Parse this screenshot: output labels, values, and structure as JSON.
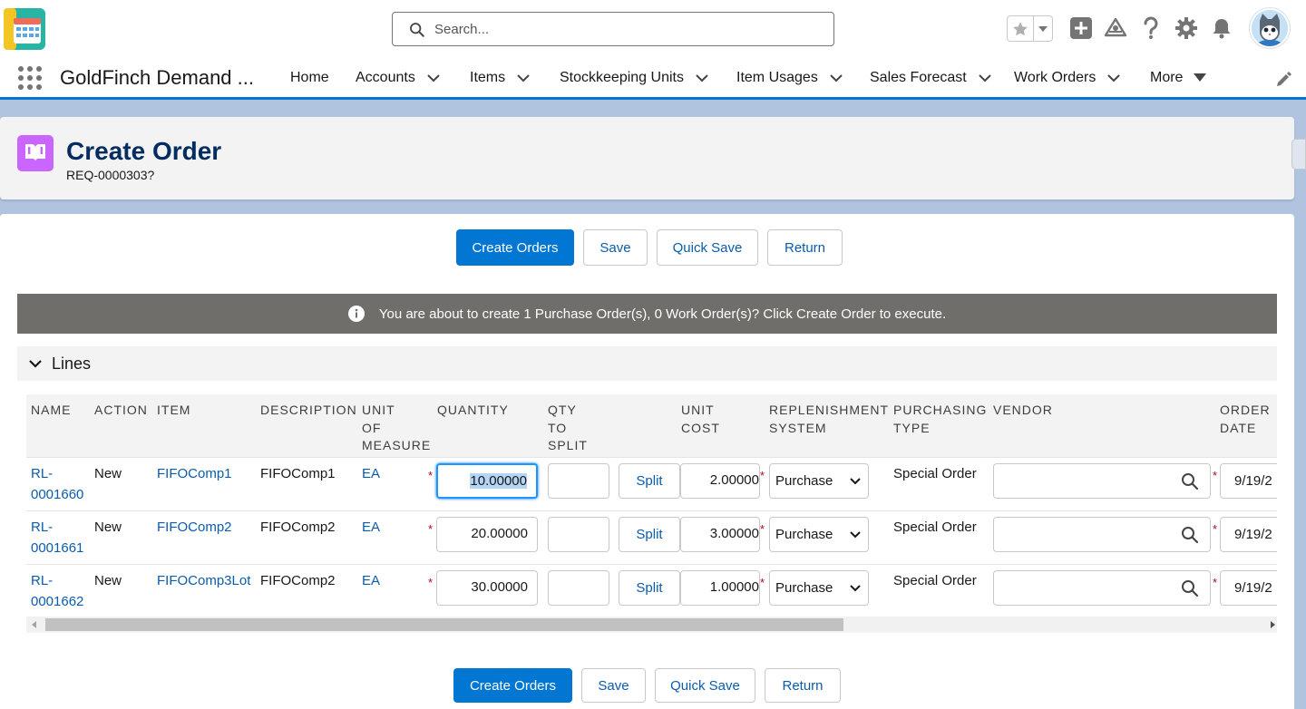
{
  "header": {
    "search_placeholder": "Search..."
  },
  "nav": {
    "app_name": "GoldFinch Demand ...",
    "items": [
      {
        "label": "Home"
      },
      {
        "label": "Accounts"
      },
      {
        "label": "Items"
      },
      {
        "label": "Stockkeeping Units"
      },
      {
        "label": "Item Usages"
      },
      {
        "label": "Sales Forecast"
      },
      {
        "label": "Work Orders"
      },
      {
        "label": "More"
      }
    ]
  },
  "page": {
    "title": "Create Order",
    "subtitle": "REQ-0000303?"
  },
  "actions": {
    "create_orders": "Create Orders",
    "save": "Save",
    "quick_save": "Quick Save",
    "return": "Return"
  },
  "info_message": "You are about to create 1 Purchase Order(s), 0 Work Order(s)? Click Create Order to execute.",
  "lines_section": {
    "title": "Lines",
    "columns": {
      "name": "NAME",
      "action": "ACTION",
      "item": "ITEM",
      "description": "DESCRIPTION",
      "uom_1": "UNIT",
      "uom_2": "OF",
      "uom_3": "MEASURE",
      "quantity": "QUANTITY",
      "qty_split_1": "QTY",
      "qty_split_2": "TO",
      "qty_split_3": "SPLIT",
      "unit_cost_1": "UNIT",
      "unit_cost_2": "COST",
      "repl_1": "REPLENISHMENT",
      "repl_2": "SYSTEM",
      "ptype_1": "PURCHASING",
      "ptype_2": "TYPE",
      "vendor": "VENDOR",
      "odate_1": "ORDER",
      "odate_2": "DATE"
    },
    "rows": [
      {
        "name_1": "RL-",
        "name_2": "0001660",
        "action": "New",
        "item": "FIFOComp1",
        "description": "FIFOComp1",
        "uom": "EA",
        "quantity": "10.00000",
        "qty_to_split": "",
        "split_label": "Split",
        "unit_cost": "2.00000",
        "replenishment": "Purchase",
        "purchasing_type": "Special Order",
        "vendor": "",
        "order_date": "9/19/2"
      },
      {
        "name_1": "RL-",
        "name_2": "0001661",
        "action": "New",
        "item": "FIFOComp2",
        "description": "FIFOComp2",
        "uom": "EA",
        "quantity": "20.00000",
        "qty_to_split": "",
        "split_label": "Split",
        "unit_cost": "3.00000",
        "replenishment": "Purchase",
        "purchasing_type": "Special Order",
        "vendor": "",
        "order_date": "9/19/2"
      },
      {
        "name_1": "RL-",
        "name_2": "0001662",
        "action": "New",
        "item": "FIFOComp3Lot",
        "description": "FIFOComp2",
        "uom": "EA",
        "quantity": "30.00000",
        "qty_to_split": "",
        "split_label": "Split",
        "unit_cost": "1.00000",
        "replenishment": "Purchase",
        "purchasing_type": "Special Order",
        "vendor": "",
        "order_date": "9/19/2"
      }
    ]
  },
  "colors": {
    "brand": "#0176d3",
    "link": "#0b5cab",
    "title": "#032d60",
    "page_icon": "#cb65ff",
    "info_bar": "#706e6b",
    "required": "#ba0517"
  }
}
